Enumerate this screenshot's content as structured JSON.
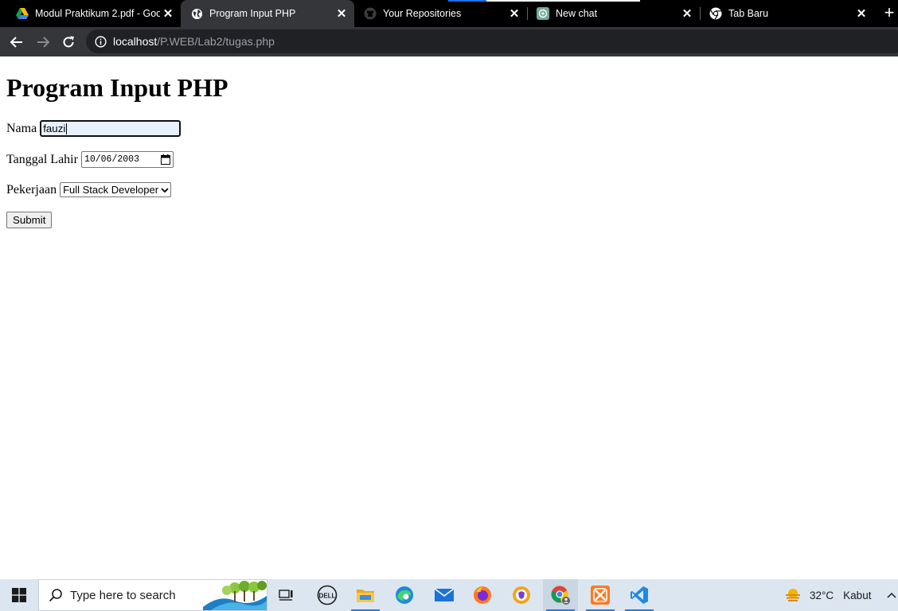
{
  "browser": {
    "tabs": [
      {
        "title": "Modul Praktikum 2.pdf - Goo",
        "icon": "google-drive-icon",
        "active": false
      },
      {
        "title": "Program Input PHP",
        "icon": "globe-icon",
        "active": true
      },
      {
        "title": "Your Repositories",
        "icon": "github-icon",
        "active": false
      },
      {
        "title": "New chat",
        "icon": "chatgpt-icon",
        "active": false
      },
      {
        "title": "Tab Baru",
        "icon": "chrome-icon",
        "active": false
      }
    ],
    "close_glyph": "✕",
    "new_tab_glyph": "+",
    "url_host": "localhost",
    "url_path": "/P.WEB/Lab2/tugas.php"
  },
  "page": {
    "heading": "Program Input PHP",
    "fields": {
      "nama": {
        "label": "Nama",
        "value": "fauzi"
      },
      "tanggal_lahir": {
        "label": "Tanggal Lahir",
        "value": "10/06/2003"
      },
      "pekerjaan": {
        "label": "Pekerjaan",
        "selected": "Full Stack Developer"
      }
    },
    "submit_label": "Submit"
  },
  "taskbar": {
    "search_placeholder": "Type here to search",
    "apps": [
      "task-view-icon",
      "dell-icon",
      "file-explorer-icon",
      "edge-icon",
      "mail-icon",
      "firefox-icon",
      "brave-icon",
      "chrome-icon",
      "xampp-icon",
      "vscode-icon"
    ],
    "weather_temp": "32°C",
    "weather_condition": "Kabut"
  },
  "colors": {
    "tab_strip": "#000000",
    "active_tab": "#35363a",
    "toolbar": "#35363a",
    "omnibox": "#202124",
    "taskbar": "#dbe6f0",
    "accent": "#2c7ad6"
  }
}
